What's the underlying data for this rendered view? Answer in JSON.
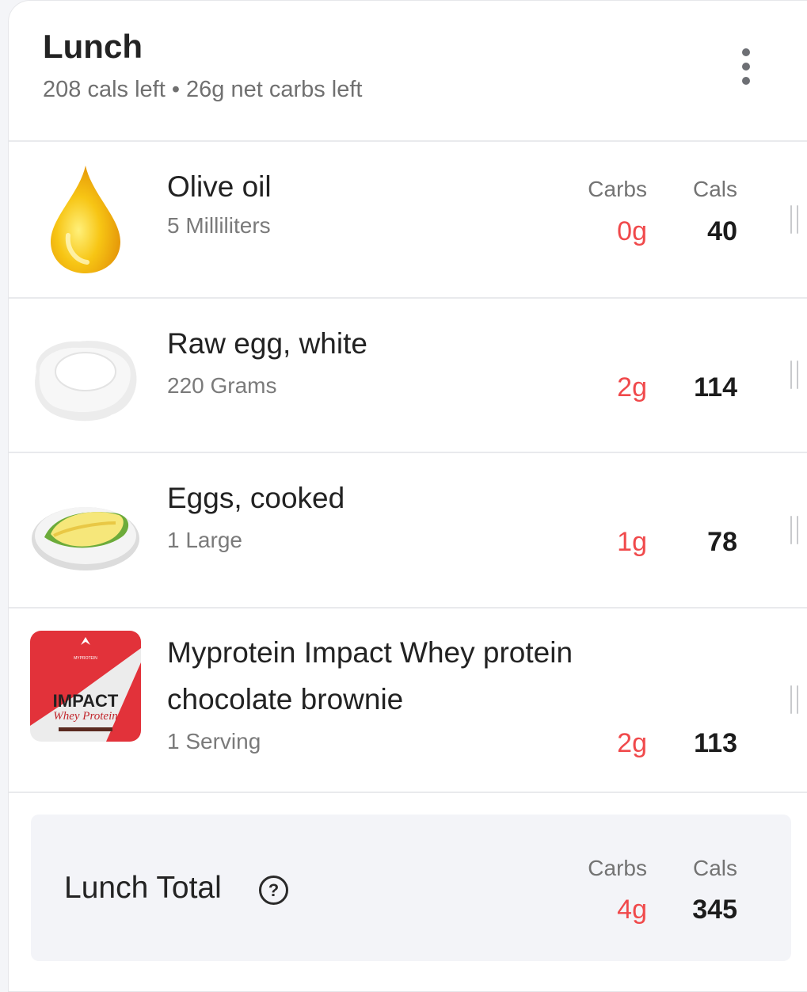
{
  "meal": {
    "title": "Lunch",
    "subtitle": "208 cals left • 26g net carbs left"
  },
  "columns": {
    "carbs": "Carbs",
    "cals": "Cals"
  },
  "icons": {
    "more": "more-vertical-icon",
    "drag": "drag-handle-icon",
    "help": "question-circle-icon"
  },
  "colors": {
    "carbs": "#f0494b",
    "text": "#222222",
    "muted": "#7a7a7a"
  },
  "items": [
    {
      "name": "Olive oil",
      "serving": "5 Milliliters",
      "carbs": "0g",
      "cals": "40",
      "image": "olive-oil-drop"
    },
    {
      "name": "Raw egg, white",
      "serving": "220 Grams",
      "carbs": "2g",
      "cals": "114",
      "image": "raw-egg-white"
    },
    {
      "name": "Eggs, cooked",
      "serving": "1 Large",
      "carbs": "1g",
      "cals": "78",
      "image": "omelette-plate"
    },
    {
      "name": "Myprotein Impact Whey protein chocolate brownie",
      "serving": "1 Serving",
      "carbs": "2g",
      "cals": "113",
      "image": "myprotein-pack"
    }
  ],
  "product_label": {
    "brand": "MYPROTEIN",
    "line1": "IMPACT",
    "line2": "Whey Protein"
  },
  "total": {
    "label": "Lunch Total",
    "help": "?",
    "carbs": "4g",
    "cals": "345"
  }
}
